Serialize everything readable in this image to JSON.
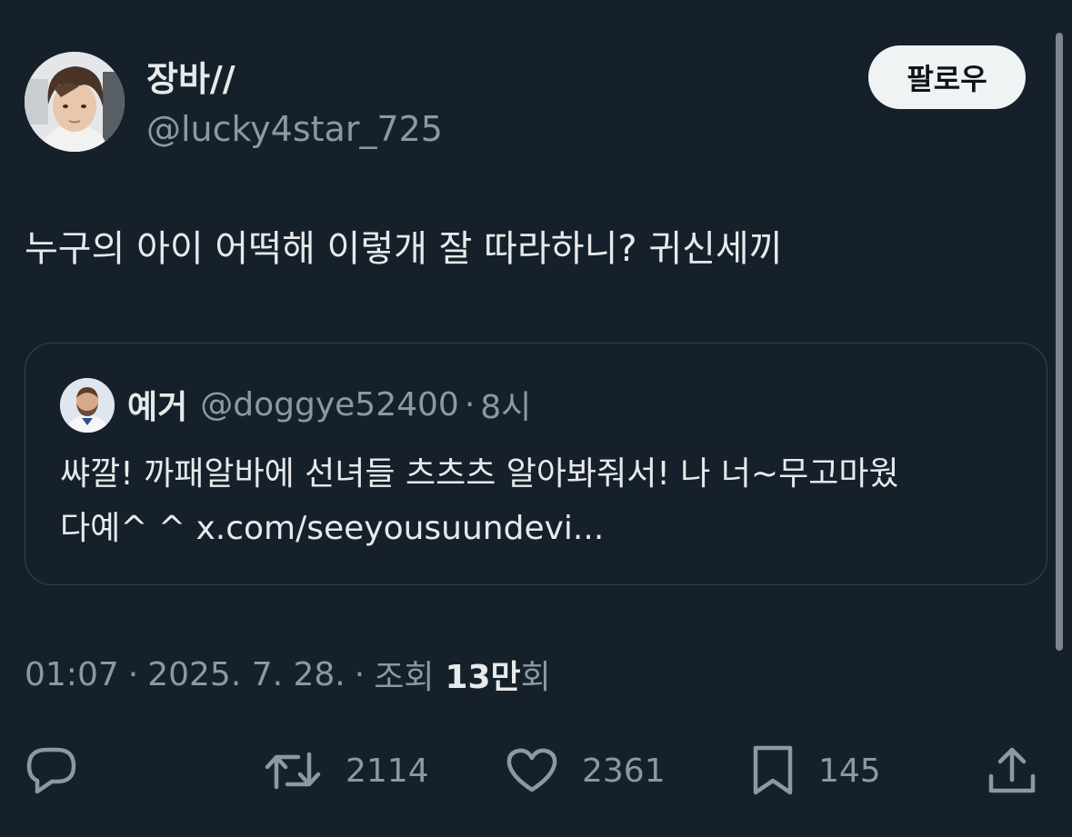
{
  "author": {
    "name": "장바//",
    "handle": "@lucky4star_725",
    "avatar_icon": "user-avatar-photo"
  },
  "follow_label": "팔로우",
  "tweet_text": "누구의 아이 어떡해 이렇개 잘 따라하니? 귀신세끼",
  "quote": {
    "name": "예거",
    "handle": "@doggye52400",
    "separator": "·",
    "time": "8시",
    "text_line1": "쌰깔! 까패알바에 선녀들 츠츠츠 알아봐줘서! 나 너~무고마웠",
    "text_line2": "다예^ ^ x.com/seeyousuundevi..."
  },
  "meta": {
    "time": "01:07",
    "separator": "·",
    "date": "2025. 7. 28.",
    "views_prefix": "조회",
    "views_count": "13만",
    "views_suffix": "회"
  },
  "actions": {
    "reply_icon": "reply-icon",
    "retweet_icon": "retweet-icon",
    "retweet_count": "2114",
    "like_icon": "heart-icon",
    "like_count": "2361",
    "bookmark_icon": "bookmark-icon",
    "bookmark_count": "145",
    "share_icon": "share-icon"
  },
  "colors": {
    "background": "#15202b",
    "text_primary": "#e7e9ea",
    "text_secondary": "#8b98a5",
    "border": "#38444d",
    "follow_button_bg": "#eff3f4"
  }
}
